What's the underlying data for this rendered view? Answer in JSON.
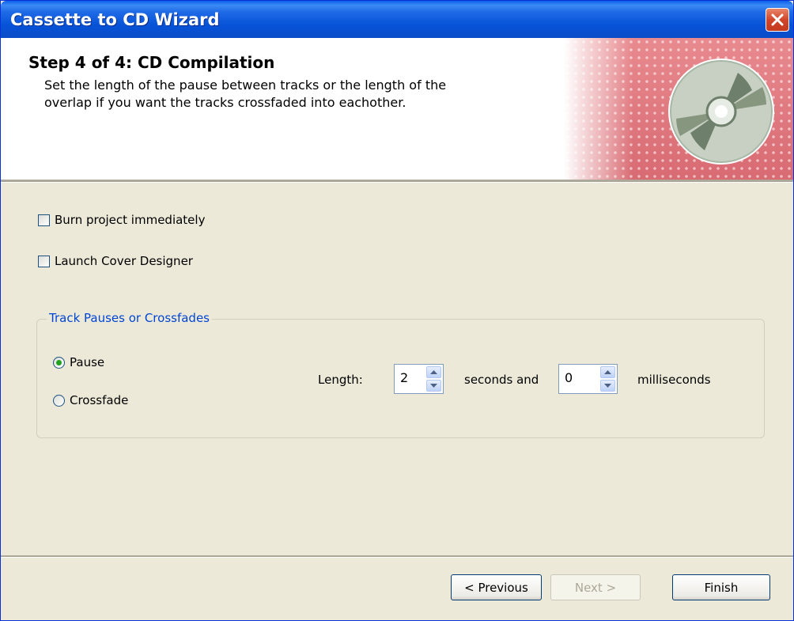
{
  "window": {
    "title": "Cassette to CD Wizard"
  },
  "header": {
    "step_title": "Step 4 of 4: CD Compilation",
    "description_line1": "Set the length of the pause between tracks or the length of the",
    "description_line2": "overlap if you want the tracks crossfaded into eachother."
  },
  "options": {
    "burn_immediately": {
      "label": "Burn project immediately",
      "checked": false
    },
    "launch_cover_designer": {
      "label": "Launch Cover Designer",
      "checked": false
    }
  },
  "track_group": {
    "legend": "Track Pauses or Crossfades",
    "pause_label": "Pause",
    "crossfade_label": "Crossfade",
    "selected": "Pause",
    "length_label": "Length:",
    "seconds_value": "2",
    "seconds_label": "seconds and",
    "milliseconds_value": "0",
    "milliseconds_label": "milliseconds"
  },
  "buttons": {
    "previous": "< Previous",
    "next": "Next >",
    "finish": "Finish"
  },
  "colors": {
    "titlebar": "#0653d8",
    "accent": "#0046d5",
    "dialog_bg": "#ece9d8",
    "header_pattern": "#d86a72"
  }
}
